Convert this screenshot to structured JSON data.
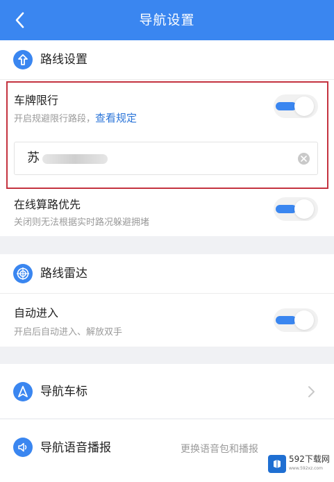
{
  "header": {
    "title": "导航设置"
  },
  "route_settings": {
    "title": "路线设置",
    "plate_restriction": {
      "title": "车牌限行",
      "subtitle": "开启规避限行路段，",
      "link": "查看规定",
      "enabled": true,
      "plate_prefix": "苏"
    },
    "online_routing": {
      "title": "在线算路优先",
      "subtitle": "关闭则无法根据实时路况躲避拥堵",
      "enabled": true
    }
  },
  "route_radar": {
    "title": "路线雷达",
    "auto_enter": {
      "title": "自动进入",
      "subtitle": "开启后自动进入、解放双手",
      "enabled": true
    }
  },
  "nav_car_icon": {
    "title": "导航车标"
  },
  "nav_voice": {
    "title": "导航语音播报",
    "value": "更换语音包和播报"
  },
  "watermark": {
    "text": "592下载网",
    "sub": "www.592xz.com"
  },
  "colors": {
    "accent": "#3a86f0",
    "highlight": "#c4323f"
  }
}
